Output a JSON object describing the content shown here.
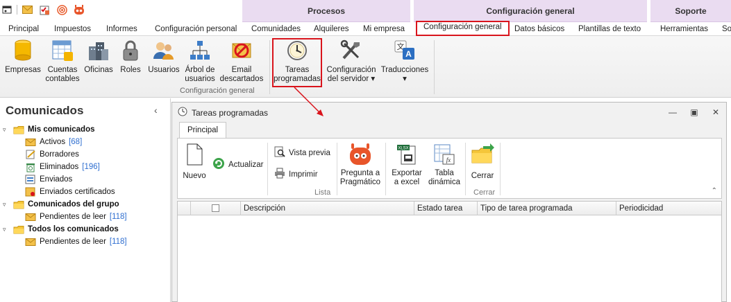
{
  "qat": {
    "icons": [
      "window-icon",
      "mail-icon",
      "checklist-icon",
      "signal-icon",
      "robot-icon"
    ]
  },
  "context_groups": [
    {
      "label": "Procesos"
    },
    {
      "label": "Configuración general"
    },
    {
      "label": "Soporte"
    }
  ],
  "tabs": [
    {
      "label": "Principal"
    },
    {
      "label": "Impuestos"
    },
    {
      "label": "Informes"
    },
    {
      "label": "Configuración personal"
    },
    {
      "label": "Comunidades"
    },
    {
      "label": "Alquileres"
    },
    {
      "label": "Mi empresa"
    },
    {
      "label": "Configuración general",
      "active": true
    },
    {
      "label": "Datos básicos"
    },
    {
      "label": "Plantillas de texto"
    },
    {
      "label": "Herramientas"
    },
    {
      "label": "So"
    }
  ],
  "ribbon": {
    "group_label": "Configuración general",
    "buttons": [
      {
        "label1": "Empresas",
        "label2": "",
        "icon": "cylinder-icon"
      },
      {
        "label1": "Cuentas",
        "label2": "contables",
        "icon": "spreadsheet-icon"
      },
      {
        "label1": "Oficinas",
        "label2": "",
        "icon": "buildings-icon"
      },
      {
        "label1": "Roles",
        "label2": "",
        "icon": "padlock-icon"
      },
      {
        "label1": "Usuarios",
        "label2": "",
        "icon": "users-icon"
      },
      {
        "label1": "Árbol de",
        "label2": "usuarios",
        "icon": "org-tree-icon"
      },
      {
        "label1": "Email",
        "label2": "descartados",
        "icon": "blocked-email-icon"
      },
      {
        "label1": "Tareas",
        "label2": "programadas",
        "icon": "clock-icon"
      },
      {
        "label1": "Configuración",
        "label2": "del servidor ▾",
        "icon": "tools-icon"
      },
      {
        "label1": "Traducciones",
        "label2": "▾",
        "icon": "translate-icon"
      }
    ]
  },
  "sidebar": {
    "title": "Comunicados",
    "collapse_glyph": "‹",
    "tree": [
      {
        "label": "Mis comunicados",
        "count": "",
        "level": 0,
        "bold": true,
        "icon": "folder-icon"
      },
      {
        "label": "Activos",
        "count": "[68]",
        "level": 1,
        "bold": false,
        "icon": "envelope-icon"
      },
      {
        "label": "Borradores",
        "count": "",
        "level": 1,
        "bold": false,
        "icon": "draft-icon"
      },
      {
        "label": "Eliminados",
        "count": "[196]",
        "level": 1,
        "bold": false,
        "icon": "trash-icon"
      },
      {
        "label": "Enviados",
        "count": "",
        "level": 1,
        "bold": false,
        "icon": "sent-icon"
      },
      {
        "label": "Enviados certificados",
        "count": "",
        "level": 1,
        "bold": false,
        "icon": "certified-icon"
      },
      {
        "label": "Comunicados del grupo",
        "count": "",
        "level": 0,
        "bold": true,
        "icon": "folder-icon"
      },
      {
        "label": "Pendientes de leer",
        "count": "[118]",
        "level": 1,
        "bold": false,
        "icon": "envelope-icon"
      },
      {
        "label": "Todos los comunicados",
        "count": "",
        "level": 0,
        "bold": true,
        "icon": "folder-icon"
      },
      {
        "label": "Pendientes de leer",
        "count": "[118]",
        "level": 1,
        "bold": false,
        "icon": "envelope-icon"
      }
    ]
  },
  "window": {
    "title": "Tareas programadas",
    "tab": "Principal",
    "buttons": {
      "nuevo": "Nuevo",
      "actualizar": "Actualizar",
      "vista_previa": "Vista previa",
      "imprimir": "Imprimir",
      "pregunta_1": "Pregunta a",
      "pregunta_2": "Pragmático",
      "exportar_1": "Exportar",
      "exportar_2": "a excel",
      "tabla_1": "Tabla",
      "tabla_2": "dinámica",
      "cerrar": "Cerrar"
    },
    "group_labels": {
      "lista": "Lista",
      "cerrar": "Cerrar"
    },
    "columns": [
      "Descripción",
      "Estado tarea",
      "Tipo de tarea programada",
      "Periodicidad"
    ]
  },
  "colors": {
    "highlight": "#d9141c",
    "context_bg": "#eadcf1",
    "count_blue": "#2f6fd0"
  }
}
